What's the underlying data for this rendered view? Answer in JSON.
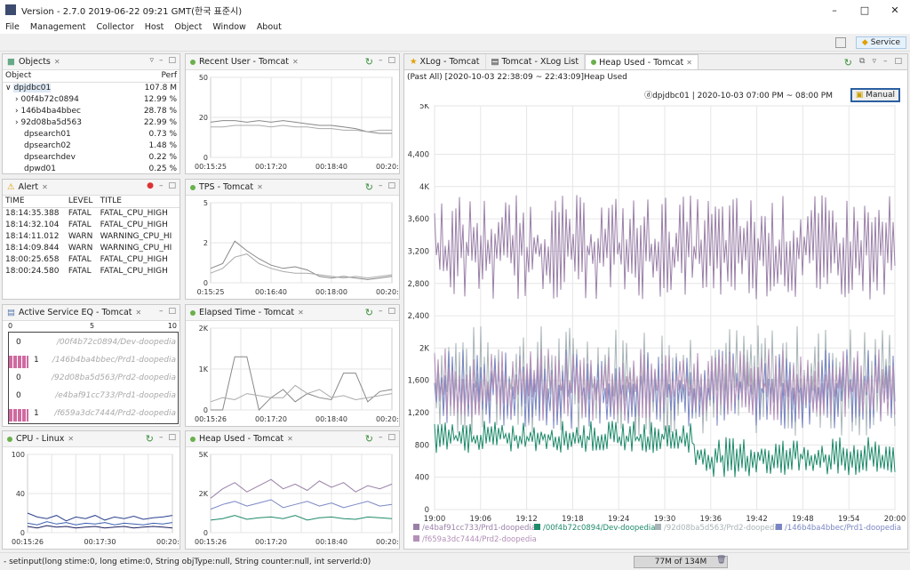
{
  "window": {
    "title": "Version - 2.7.0 2019-06-22 09:21 GMT(한국 표준시)"
  },
  "menu": [
    "File",
    "Management",
    "Collector",
    "Host",
    "Object",
    "Window",
    "About"
  ],
  "toolbar": {
    "service_label": "Service"
  },
  "objects": {
    "title": "Objects",
    "col_object": "Object",
    "col_perf": "Perf",
    "rows": [
      {
        "name": "dpjdbc01",
        "perf": "107.8 M"
      },
      {
        "name": "00f4b72c0894",
        "perf": "12.99 %"
      },
      {
        "name": "146b4ba4bbec",
        "perf": "28.78 %"
      },
      {
        "name": "92d08ba5d563",
        "perf": "22.99 %"
      },
      {
        "name": "dpsearch01",
        "perf": "0.73 %"
      },
      {
        "name": "dpsearch02",
        "perf": "1.48 %"
      },
      {
        "name": "dpsearchdev",
        "perf": "0.22 %"
      },
      {
        "name": "dpwd01",
        "perf": "0.25 %"
      }
    ]
  },
  "alert": {
    "title": "Alert",
    "col_time": "TIME",
    "col_level": "LEVEL",
    "col_title": "TITLE",
    "rows": [
      {
        "time": "18:14:35.388",
        "level": "FATAL",
        "title": "FATAL_CPU_HIGH"
      },
      {
        "time": "18:14:32.104",
        "level": "FATAL",
        "title": "FATAL_CPU_HIGH"
      },
      {
        "time": "18:14:11.012",
        "level": "WARN",
        "title": "WARNING_CPU_HI"
      },
      {
        "time": "18:14:09.844",
        "level": "WARN",
        "title": "WARNING_CPU_HI"
      },
      {
        "time": "18:00:25.658",
        "level": "FATAL",
        "title": "FATAL_CPU_HIGH"
      },
      {
        "time": "18:00:24.580",
        "level": "FATAL",
        "title": "FATAL_CPU_HIGH"
      }
    ]
  },
  "active_service": {
    "title": "Active Service EQ - Tomcat",
    "scale": [
      "0",
      "5",
      "10"
    ],
    "rows": [
      {
        "count": "0",
        "name": "/00f4b72c0894/Dev-doopedia",
        "level": 0
      },
      {
        "count": "1",
        "name": "/146b4ba4bbec/Prd1-doopedia",
        "level": 1
      },
      {
        "count": "0",
        "name": "/92d08ba5d563/Prd2-doopedia",
        "level": 0
      },
      {
        "count": "0",
        "name": "/e4baf91cc733/Prd1-doopedia",
        "level": 0
      },
      {
        "count": "1",
        "name": "/f659a3dc7444/Prd2-doopedia",
        "level": 1
      }
    ]
  },
  "tabs": [
    {
      "label": "XLog - Tomcat"
    },
    {
      "label": "Tomcat - XLog List"
    },
    {
      "label": "Heap Used - Tomcat"
    }
  ],
  "heap": {
    "subtitle": "(Past All) [2020-10-03 22:38:09 ~ 22:43:09]Heap Used",
    "info": "ⓓdpjdbc01 | 2020-10-03 07:00 PM ~ 08:00 PM",
    "manual_label": "Manual"
  },
  "colors": {
    "purple": "#9a80a8",
    "green": "#1e8a6a",
    "gray": "#a8b4b8",
    "blue": "#7a86c4",
    "pink": "#d06aa0"
  },
  "chart_data": [
    {
      "id": "recent_user",
      "panel_title": "Recent User - Tomcat",
      "type": "line",
      "ylim": [
        0,
        50
      ],
      "yticks": [
        "50",
        "20",
        "0"
      ],
      "xticks": [
        "00:15:25",
        "00:17:20",
        "00:18:40",
        "00:20:25"
      ],
      "series": [
        {
          "values": [
            22,
            23,
            23,
            22,
            23,
            22,
            23,
            22,
            21,
            20,
            20,
            19,
            18,
            16,
            15,
            15
          ]
        },
        {
          "values": [
            19,
            19,
            20,
            20,
            20,
            19,
            20,
            19,
            19,
            18,
            18,
            17,
            17,
            16,
            17,
            17
          ]
        }
      ]
    },
    {
      "id": "tps",
      "panel_title": "TPS - Tomcat",
      "type": "line",
      "ylim": [
        0,
        5
      ],
      "yticks": [
        "5",
        "2",
        "0"
      ],
      "xticks": [
        "0:15:25",
        "00:16:40",
        "00:18:00",
        "00:20:25"
      ],
      "series": [
        {
          "values": [
            0.9,
            1.2,
            2.6,
            2.0,
            1.5,
            1.1,
            0.9,
            1.0,
            0.8,
            0.4,
            0.3,
            0.4,
            0.3,
            0.2,
            0.3,
            0.4
          ]
        },
        {
          "values": [
            0.6,
            0.9,
            1.6,
            1.8,
            1.2,
            0.9,
            0.7,
            0.6,
            0.6,
            0.5,
            0.4,
            0.3,
            0.4,
            0.3,
            0.4,
            0.5
          ]
        }
      ]
    },
    {
      "id": "elapsed",
      "panel_title": "Elapsed Time - Tomcat",
      "type": "line",
      "ylim": [
        0,
        2000
      ],
      "yticks": [
        "2K",
        "1K",
        "0"
      ],
      "xticks": [
        "00:15:26",
        "00:17:20",
        "00:18:40",
        "00:20:26"
      ],
      "series": [
        {
          "values": [
            0,
            0,
            1300,
            1300,
            0,
            300,
            500,
            200,
            400,
            300,
            250,
            900,
            900,
            200,
            450,
            500
          ]
        },
        {
          "values": [
            200,
            300,
            250,
            400,
            350,
            300,
            300,
            600,
            400,
            500,
            300,
            350,
            250,
            300,
            350,
            400
          ]
        }
      ]
    },
    {
      "id": "cpu",
      "panel_title": "CPU - Linux",
      "type": "line",
      "ylim": [
        0,
        100
      ],
      "yticks": [
        "100",
        "40",
        "0"
      ],
      "xticks": [
        "00:15:26",
        "00:17:30",
        "00:20:26"
      ],
      "series": [
        {
          "values": [
            25,
            20,
            18,
            22,
            15,
            20,
            18,
            22,
            16,
            20,
            18,
            21,
            17,
            19,
            20,
            22
          ]
        },
        {
          "values": [
            12,
            10,
            14,
            11,
            13,
            10,
            12,
            11,
            13,
            10,
            12,
            11,
            10,
            12,
            11,
            13
          ]
        },
        {
          "values": [
            8,
            6,
            9,
            7,
            8,
            6,
            7,
            8,
            6,
            7,
            8,
            6,
            7,
            8,
            7,
            6
          ]
        }
      ]
    },
    {
      "id": "heap_small",
      "panel_title": "Heap Used - Tomcat",
      "type": "line",
      "ylim": [
        0,
        5000
      ],
      "yticks": [
        "5K",
        "2K",
        "0"
      ],
      "xticks": [
        "00:15:26",
        "00:17:20",
        "00:18:40",
        "00:20:26"
      ],
      "series": [
        {
          "values": [
            2200,
            2800,
            3200,
            2600,
            3000,
            3400,
            2800,
            3100,
            2700,
            3300,
            2900,
            3200,
            2600,
            3000,
            2800,
            3100
          ]
        },
        {
          "values": [
            1500,
            1800,
            2000,
            1700,
            1900,
            2100,
            1600,
            1800,
            2000,
            1700,
            1900,
            1600,
            1800,
            2000,
            1700,
            1800
          ]
        },
        {
          "values": [
            800,
            900,
            1100,
            850,
            950,
            1000,
            900,
            1100,
            800,
            950,
            1000,
            900,
            850,
            1000,
            950,
            900
          ]
        }
      ]
    },
    {
      "id": "heap_main",
      "type": "line",
      "ylim": [
        0,
        5000
      ],
      "yticks": [
        "5K",
        "4,400",
        "4K",
        "3,600",
        "3,200",
        "2,800",
        "2,400",
        "2K",
        "1,600",
        "1,200",
        "800",
        "400",
        "0"
      ],
      "xticks": [
        "19:00",
        "19:06",
        "19:12",
        "19:18",
        "19:24",
        "19:30",
        "19:36",
        "19:42",
        "19:48",
        "19:54",
        "20:00"
      ],
      "series": [
        {
          "name": "/e4baf91cc733/Prd1-doopedia",
          "color": "#9a80a8",
          "range": [
            2600,
            3900
          ]
        },
        {
          "name": "/00f4b72c0894/Dev-doopedia",
          "color": "#1e8a6a",
          "range": [
            700,
            1100
          ],
          "range2": [
            400,
            900
          ]
        },
        {
          "name": "/92d08ba5d563/Prd2-doopedia",
          "color": "#a8b4b8",
          "range": [
            900,
            2300
          ]
        },
        {
          "name": "/146b4ba4bbec/Prd1-doopedia",
          "color": "#7a86c4",
          "range": [
            1000,
            2000
          ]
        },
        {
          "name": "/f659a3dc7444/Prd2-doopedia",
          "color": "#b490b8",
          "range": [
            1100,
            2000
          ]
        }
      ]
    }
  ],
  "status": {
    "command": "- setinput(long stime:0, long etime:0, String objType:null, String counter:null, int serverId:0)",
    "memory": "77M of 134M"
  }
}
